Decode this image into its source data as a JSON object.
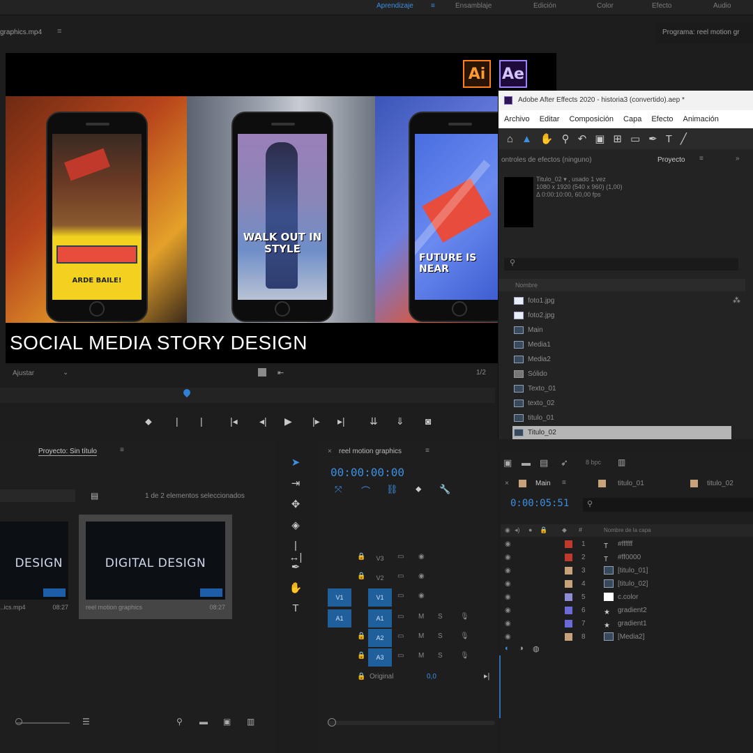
{
  "topbar": {
    "workspaces": [
      "Aprendizaje",
      "≡",
      "Ensamblaje",
      "Edición",
      "Color",
      "Efecto",
      "Audio"
    ]
  },
  "source": {
    "title": "graphics.mp4",
    "program_title": "Programa: reel motion gr",
    "fit_label": "Ajustar",
    "fraction": "1/2"
  },
  "banner": {
    "title": "SOCIAL MEDIA STORY DESIGN",
    "phone1_text": "ARDE BAILE!",
    "phone2_text": "WALK OUT IN STYLE",
    "phone3_text": "FUTURE IS NEAR",
    "ai_label": "Ai",
    "ae_label": "Ae"
  },
  "ae": {
    "title": "Adobe After Effects 2020 - historia3 (convertido).aep *",
    "menu": [
      "Archivo",
      "Editar",
      "Composición",
      "Capa",
      "Efecto",
      "Animación"
    ],
    "panel_left": "ontroles de efectos (ninguno)",
    "panel_right": "Proyecto",
    "comp_name": "Titulo_02 ▾ , usado 1 vez",
    "comp_size": "1080 x 1920 (540 x 960) (1,00)",
    "comp_duration": "Δ 0:00:10:00, 60,00 fps",
    "list_header": "Nombre",
    "items": [
      {
        "name": "foto1.jpg",
        "selected": false
      },
      {
        "name": "foto2.jpg",
        "selected": false
      },
      {
        "name": "Main",
        "selected": false
      },
      {
        "name": "Media1",
        "selected": false
      },
      {
        "name": "Media2",
        "selected": false
      },
      {
        "name": "Sólido",
        "selected": false
      },
      {
        "name": "Texto_01",
        "selected": false
      },
      {
        "name": "texto_02",
        "selected": false
      },
      {
        "name": "titulo_01",
        "selected": false
      },
      {
        "name": "Titulo_02",
        "selected": true
      }
    ]
  },
  "project_panel": {
    "tab": "Proyecto: Sin título",
    "selection_info": "1 de 2 elementos seleccionados",
    "clips": [
      {
        "caption": "...ics.mp4",
        "duration": "08:27",
        "thumb_text": "DESIGN"
      },
      {
        "caption": "reel motion graphics",
        "duration": "08:27",
        "thumb_text": "DIGITAL DESIGN"
      }
    ]
  },
  "timeline": {
    "tab": "reel motion graphics",
    "timecode": "00:00:00:00",
    "tracks": [
      {
        "src": "",
        "name": "V3",
        "on": false
      },
      {
        "src": "",
        "name": "V2",
        "on": false
      },
      {
        "src": "V1",
        "name": "V1",
        "on": true
      },
      {
        "src": "A1",
        "name": "A1",
        "on": true
      },
      {
        "src": "",
        "name": "A2",
        "on": true
      },
      {
        "src": "",
        "name": "A3",
        "on": true
      }
    ],
    "master_label": "Original",
    "master_value": "0,0"
  },
  "ae_timeline": {
    "tabs": [
      "Main",
      "titulo_01",
      "titulo_02"
    ],
    "timecode": "0:00:05:51",
    "column_header": "Nombre de la capa",
    "layers": [
      {
        "num": "1",
        "name": "#ffffff",
        "color": "#c0392b",
        "type": "T"
      },
      {
        "num": "2",
        "name": "#ff0000",
        "color": "#c0392b",
        "type": "T"
      },
      {
        "num": "3",
        "name": "[titulo_01]",
        "color": "#c8a27a",
        "type": "comp"
      },
      {
        "num": "4",
        "name": "[titulo_02]",
        "color": "#c8a27a",
        "type": "comp"
      },
      {
        "num": "5",
        "name": "c.color",
        "color": "#8e8ed6",
        "type": "solid"
      },
      {
        "num": "6",
        "name": "gradient2",
        "color": "#6a6ad8",
        "type": "star"
      },
      {
        "num": "7",
        "name": "gradient1",
        "color": "#6a6ad8",
        "type": "star"
      },
      {
        "num": "8",
        "name": "[Media2]",
        "color": "#c8a27a",
        "type": "comp"
      }
    ]
  },
  "colors": {
    "accent_blue": "#3d8fe0",
    "illustrator_orange": "#ff7f18",
    "aftereffects_purple": "#9f82ff"
  }
}
